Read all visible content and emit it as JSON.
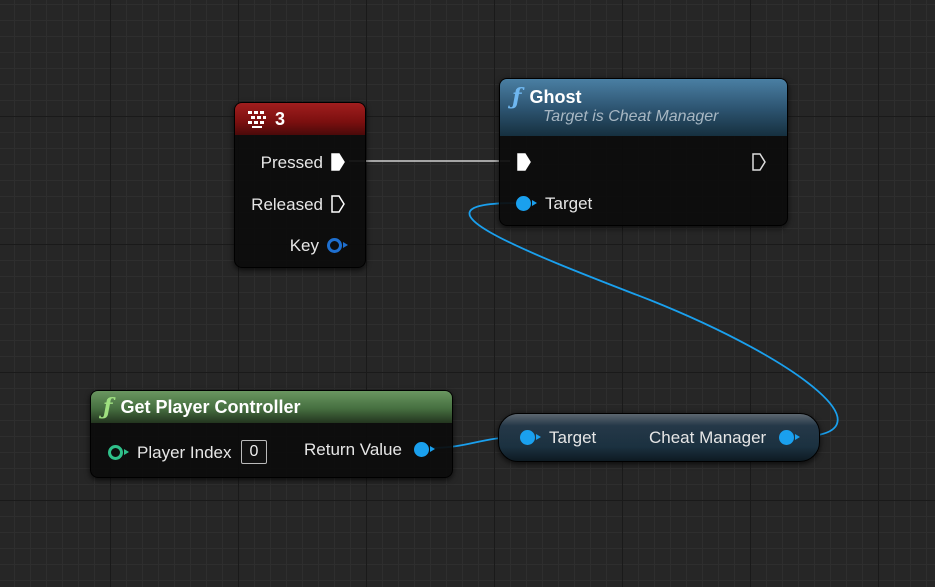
{
  "key_event": {
    "title": "3",
    "icon": "keyboard-icon",
    "pins": {
      "pressed": "Pressed",
      "released": "Released",
      "key": "Key"
    },
    "header_color": "#9b1717"
  },
  "ghost_node": {
    "title": "Ghost",
    "subtitle": "Target is Cheat Manager",
    "icon": "function-icon",
    "pins": {
      "target": "Target"
    },
    "header_color": "#3f6f91"
  },
  "get_player_controller": {
    "title": "Get Player Controller",
    "icon": "function-icon",
    "pins": {
      "player_index": "Player Index",
      "player_index_value": "0",
      "return_value": "Return Value"
    },
    "header_color": "#4f7a4a"
  },
  "cheat_manager_node": {
    "pins": {
      "target": "Target",
      "cheat_manager": "Cheat Manager"
    }
  },
  "colors": {
    "object_wire": "#1aa0ee",
    "exec_wire": "#cfcfcf"
  }
}
